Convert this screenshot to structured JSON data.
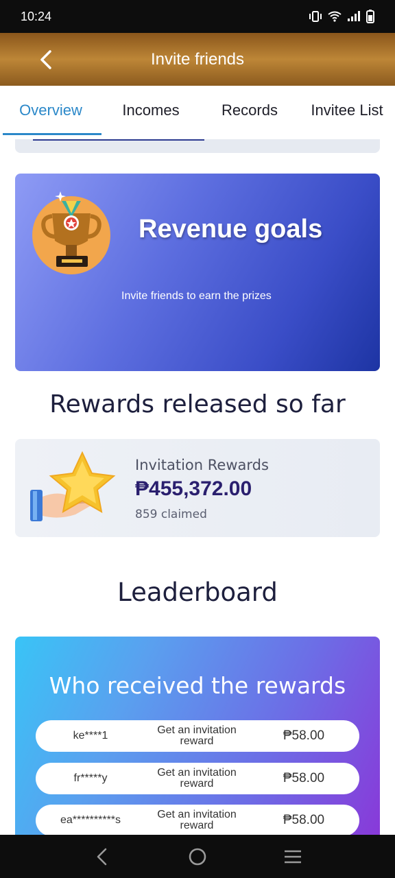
{
  "status_bar": {
    "time": "10:24",
    "icons": [
      "vibrate-icon",
      "wifi-icon",
      "signal-icon",
      "battery-icon"
    ]
  },
  "header": {
    "title": "Invite friends",
    "back_icon": "chevron-left-icon",
    "background": "#b07a2e"
  },
  "tabs": [
    {
      "label": "Overview",
      "active": true
    },
    {
      "label": "Incomes",
      "active": false
    },
    {
      "label": "Records",
      "active": false
    },
    {
      "label": "Invitee List",
      "active": false
    }
  ],
  "goal_banner": {
    "title": "Revenue goals",
    "subtitle": "Invite friends to earn the prizes",
    "icon": "trophy-icon"
  },
  "rewards_section": {
    "heading": "Rewards released so far",
    "card": {
      "label": "Invitation Rewards",
      "amount": "₱455,372.00",
      "claimed": "859 claimed",
      "icon": "star-hand-icon"
    }
  },
  "leaderboard": {
    "heading": "Leaderboard",
    "card_title": "Who received the rewards",
    "rows": [
      {
        "user": "ke****1",
        "desc": "Get an invitation reward",
        "amount": "₱58.00"
      },
      {
        "user": "fr*****y",
        "desc": "Get an invitation reward",
        "amount": "₱58.00"
      },
      {
        "user": "ea**********s",
        "desc": "Get an invitation reward",
        "amount": "₱58.00"
      }
    ]
  },
  "nav_bar": {
    "buttons": [
      "back-nav-icon",
      "home-nav-icon",
      "recents-nav-icon"
    ]
  },
  "colors": {
    "accent": "#2b88c9",
    "heading_text": "#1d1f3d",
    "amount_text": "#2a1f6e"
  }
}
